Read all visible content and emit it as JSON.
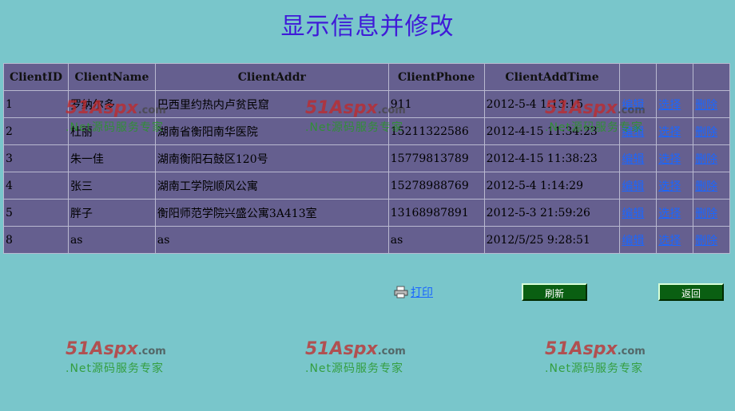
{
  "page": {
    "title": "显示信息并修改"
  },
  "table": {
    "headers": [
      "ClientID",
      "ClientName",
      "ClientAddr",
      "ClientPhone",
      "ClientAddTime",
      "",
      "",
      ""
    ],
    "rows": [
      {
        "id": "1",
        "name": "罗纳尔多",
        "addr": "巴西里约热内卢贫民窟",
        "phone": "911",
        "time": "2012-5-4 1:13:15",
        "edit": "编辑",
        "select": "选择",
        "delete": "删除"
      },
      {
        "id": "2",
        "name": "杜丽",
        "addr": "湖南省衡阳南华医院",
        "phone": "15211322586",
        "time": "2012-4-15 11:34:23",
        "edit": "编辑",
        "select": "选择",
        "delete": "删除"
      },
      {
        "id": "3",
        "name": "朱一佳",
        "addr": "湖南衡阳石鼓区120号",
        "phone": "15779813789",
        "time": "2012-4-15 11:38:23",
        "edit": "编辑",
        "select": "选择",
        "delete": "删除"
      },
      {
        "id": "4",
        "name": "张三",
        "addr": "湖南工学院顺风公寓",
        "phone": "15278988769",
        "time": "2012-5-4 1:14:29",
        "edit": "编辑",
        "select": "选择",
        "delete": "删除"
      },
      {
        "id": "5",
        "name": "胖子",
        "addr": "衡阳师范学院兴盛公寓3A413室",
        "phone": "13168987891",
        "time": "2012-5-3 21:59:26",
        "edit": "编辑",
        "select": "选择",
        "delete": "删除"
      },
      {
        "id": "8",
        "name": "as",
        "addr": "as",
        "phone": "as",
        "time": "2012/5/25 9:28:51",
        "edit": "编辑",
        "select": "选择",
        "delete": "删除"
      }
    ]
  },
  "actions": {
    "print_label": "打印",
    "print_icon": "printer-icon",
    "refresh_label": "刷新",
    "back_label": "返回"
  },
  "watermark": {
    "logo": "51Aspx",
    "logo_suffix": ".com",
    "tagline": ".Net源码服务专家"
  }
}
